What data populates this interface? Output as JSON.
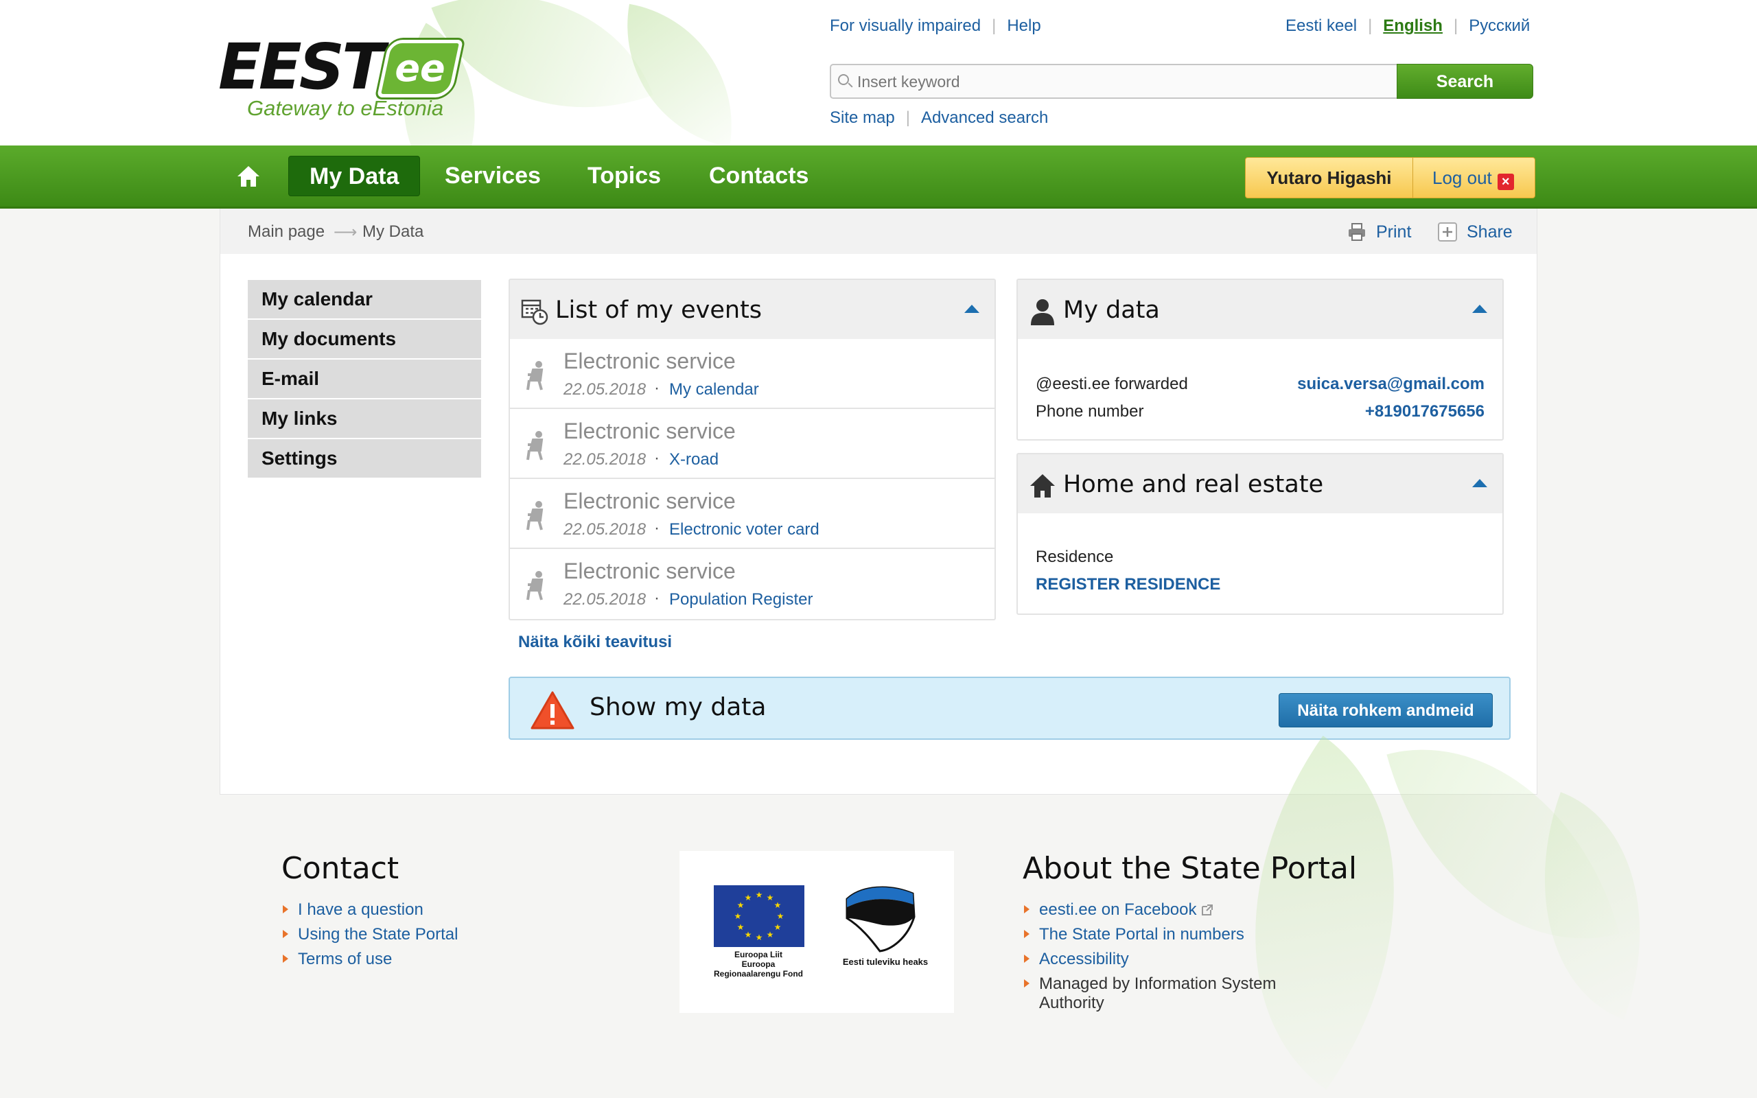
{
  "header": {
    "logo_word": "EESTI",
    "logo_badge": "ee",
    "logo_tagline": "Gateway to eEstonia",
    "accessibility_link": "For visually impaired",
    "help_link": "Help",
    "languages": [
      "Eesti keel",
      "English",
      "Русский"
    ],
    "search": {
      "placeholder": "Insert keyword",
      "button": "Search"
    },
    "site_map": "Site map",
    "advanced_search": "Advanced search"
  },
  "nav": {
    "items": [
      "My Data",
      "Services",
      "Topics",
      "Contacts"
    ],
    "active": "My Data",
    "user_name": "Yutaro Higashi",
    "logout": "Log out",
    "logout_icon": "×"
  },
  "breadcrumb": {
    "items": [
      "Main page",
      "My Data"
    ],
    "separator": "⟶"
  },
  "tools": {
    "print": "Print",
    "share": "Share"
  },
  "sidebar": {
    "items": [
      "My calendar",
      "My documents",
      "E-mail",
      "My links",
      "Settings"
    ]
  },
  "events": {
    "title": "List of my events",
    "items": [
      {
        "title": "Electronic service",
        "date": "22.05.2018",
        "link": "My calendar"
      },
      {
        "title": "Electronic service",
        "date": "22.05.2018",
        "link": "X-road"
      },
      {
        "title": "Electronic service",
        "date": "22.05.2018",
        "link": "Electronic voter card"
      },
      {
        "title": "Electronic service",
        "date": "22.05.2018",
        "link": "Population Register"
      }
    ],
    "dot": "·",
    "show_all": "Näita kõiki teavitusi"
  },
  "my_data": {
    "title": "My data",
    "rows": [
      {
        "label": "@eesti.ee forwarded",
        "value": "suica.versa@gmail.com"
      },
      {
        "label": "Phone number",
        "value": "+819017675656"
      }
    ]
  },
  "home_estate": {
    "title": "Home and real estate",
    "label": "Residence",
    "action": "REGISTER RESIDENCE"
  },
  "alert": {
    "title": "Show my data",
    "button": "Näita rohkem andmeid"
  },
  "footer": {
    "contact_title": "Contact",
    "contact_links": [
      "I have a question",
      "Using the State Portal",
      "Terms of use"
    ],
    "about_title": "About the State Portal",
    "about_links": [
      "eesti.ee on Facebook",
      "The State Portal in numbers",
      "Accessibility"
    ],
    "managed_line1": "Managed by Information System",
    "managed_line2": "Authority",
    "eu_caption": [
      "Euroopa Liit",
      "Euroopa",
      "Regionaalarengu Fond"
    ],
    "est_caption": "Eesti tuleviku heaks"
  },
  "colors": {
    "brand_green": "#4a9a20",
    "link_blue": "#1d5fa0",
    "user_yellow": "#f7c84f",
    "alert_bg": "#d7effa"
  }
}
